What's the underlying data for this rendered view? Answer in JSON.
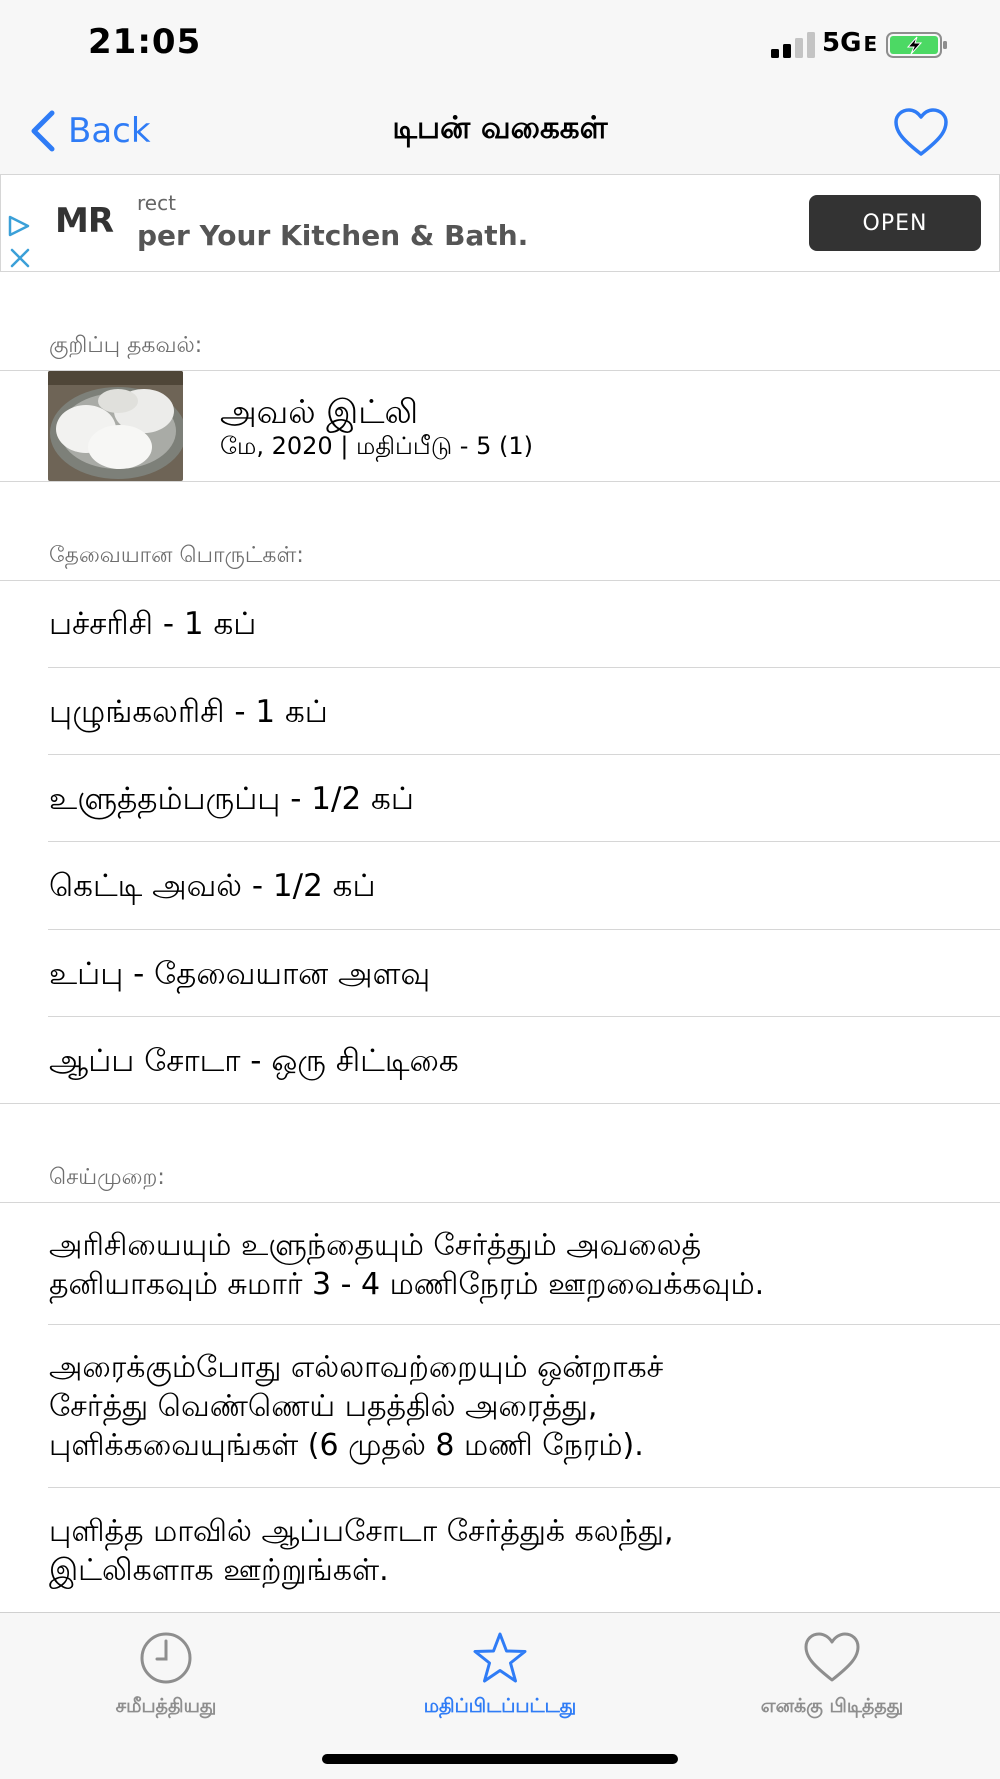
{
  "status_bar": {
    "time": "21:05",
    "network": "5G",
    "network_suffix": "E"
  },
  "nav": {
    "back_label": "Back",
    "title": "டிபன் வகைகள்",
    "accent_color": "#2f7cf6"
  },
  "ad": {
    "logo": "MR",
    "small_text": "rect",
    "headline": "​per Your Kitchen & Bath.",
    "open_label": "OPEN"
  },
  "recipe_info": {
    "header": "குறிப்பு தகவல்:",
    "name": "அவல் இட்லி",
    "meta": "மே, 2020 | மதிப்பீடு - 5 (1)"
  },
  "ingredients": {
    "header": "தேவையான பொருட்கள்:",
    "items": [
      "பச்சரிசி - 1 கப்",
      "புழுங்கலரிசி - 1 கப்",
      "உளுத்தம்பருப்பு - 1/2 கப்",
      "கெட்டி அவல் - 1/2 கப்",
      "உப்பு - தேவையான அளவு",
      "ஆப்ப சோடா - ஒரு சிட்டிகை"
    ]
  },
  "method": {
    "header": "செய்முறை:",
    "steps": [
      "அரிசியையும் உளுந்தையும் சேர்த்தும் அவலைத்\nதனியாகவும் சுமார் 3 - 4 மணிநேரம் ஊறவைக்கவும்.",
      "அரைக்கும்போது எல்லாவற்றையும் ஒன்றாகச்\nசேர்த்து வெண்ணெய் பதத்தில்  அரைத்து,\nபுளிக்கவையுங்கள் (6 முதல் 8 மணி நேரம்).",
      "புளித்த மாவில் ஆப்பசோடா சேர்த்துக் கலந்து,\nஇட்லிகளாக ஊற்றுங்கள்."
    ]
  },
  "tabs": [
    {
      "label": "சமீபத்தியது",
      "icon": "clock-icon",
      "active": false
    },
    {
      "label": "மதிப்பிடப்பட்டது",
      "icon": "star-icon",
      "active": true
    },
    {
      "label": "எனக்கு பிடித்தது",
      "icon": "heart-icon",
      "active": false
    }
  ],
  "colors": {
    "active_tab": "#2f7cf6",
    "inactive_tab": "#8e8e8e",
    "battery": "#4cd964"
  }
}
